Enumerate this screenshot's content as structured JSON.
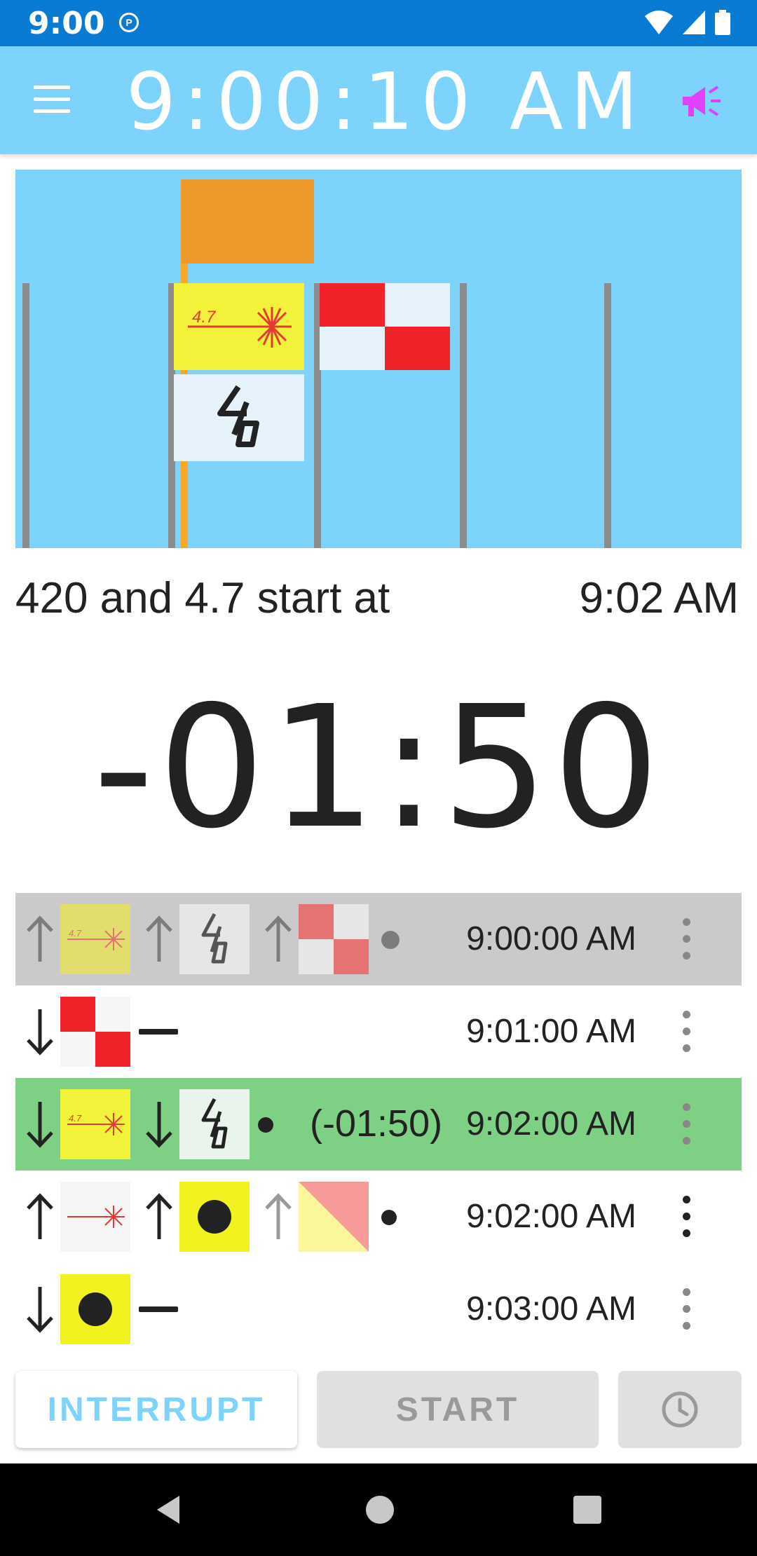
{
  "status_bar": {
    "time": "9:00",
    "app_icon": "P"
  },
  "app_bar": {
    "clock": "9:00:10 AM",
    "menu_icon": "menu-icon",
    "horn_icon": "horn-icon"
  },
  "flag_panel": {
    "orange_flag_color": "#ee9a2b",
    "class_flag_47_label": "4.7",
    "class_flag_420_label": "420"
  },
  "next_start": {
    "label": "420 and 4.7 start at",
    "time": "9:02 AM"
  },
  "countdown": "-01:50",
  "sequence": [
    {
      "time": "9:00:00 AM",
      "state": "past"
    },
    {
      "time": "9:01:00 AM",
      "state": "normal"
    },
    {
      "time": "9:02:00 AM",
      "offset": "(-01:50)",
      "state": "active"
    },
    {
      "time": "9:02:00 AM",
      "state": "normal"
    },
    {
      "time": "9:03:00 AM",
      "state": "normal"
    }
  ],
  "buttons": {
    "interrupt": "INTERRUPT",
    "start": "START",
    "clock_icon": "clock-icon"
  },
  "colors": {
    "accent": "#7dd3fb",
    "active_row": "#7ed085",
    "past_row": "#cbc9cb",
    "status_bar": "#0a7bd3",
    "horn": "#e040fb"
  }
}
